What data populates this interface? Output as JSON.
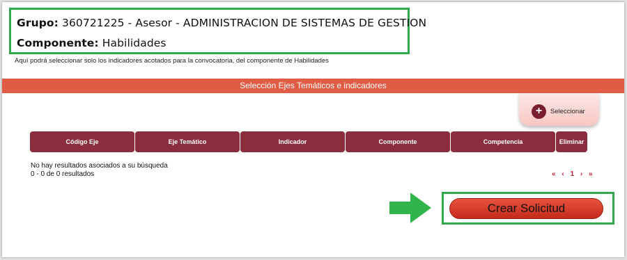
{
  "header": {
    "grupo_label": "Grupo:",
    "grupo_value": "360721225 - Asesor - ADMINISTRACION DE SISTEMAS DE GESTION",
    "componente_label": "Componente:",
    "componente_value": "Habilidades",
    "description": "Aquí podrá seleccionar solo los indicadores acotados para la convocatoria, del componente de Habilidades"
  },
  "section": {
    "title": "Selección Ejes Temáticos e indicadores"
  },
  "select_button": {
    "icon": "plus-circle-icon",
    "label": "Seleccionar"
  },
  "table": {
    "columns": [
      "Código Eje",
      "Eje Temático",
      "Indicador",
      "Componente",
      "Competencia",
      "Eliminar"
    ],
    "empty_message": "No hay resultados asociados a su búsqueda",
    "results_summary": "0 - 0 de 0 resultados"
  },
  "pagination": {
    "first": "«",
    "prev": "‹",
    "page": "1",
    "next": "›",
    "last": "»"
  },
  "actions": {
    "crear_label": "Crear Solicitud"
  },
  "colors": {
    "section_bar": "#e05c45",
    "table_header": "#8b2d3c",
    "highlight": "#2fa84f",
    "button": "#d8402f",
    "pager": "#c0202c"
  }
}
